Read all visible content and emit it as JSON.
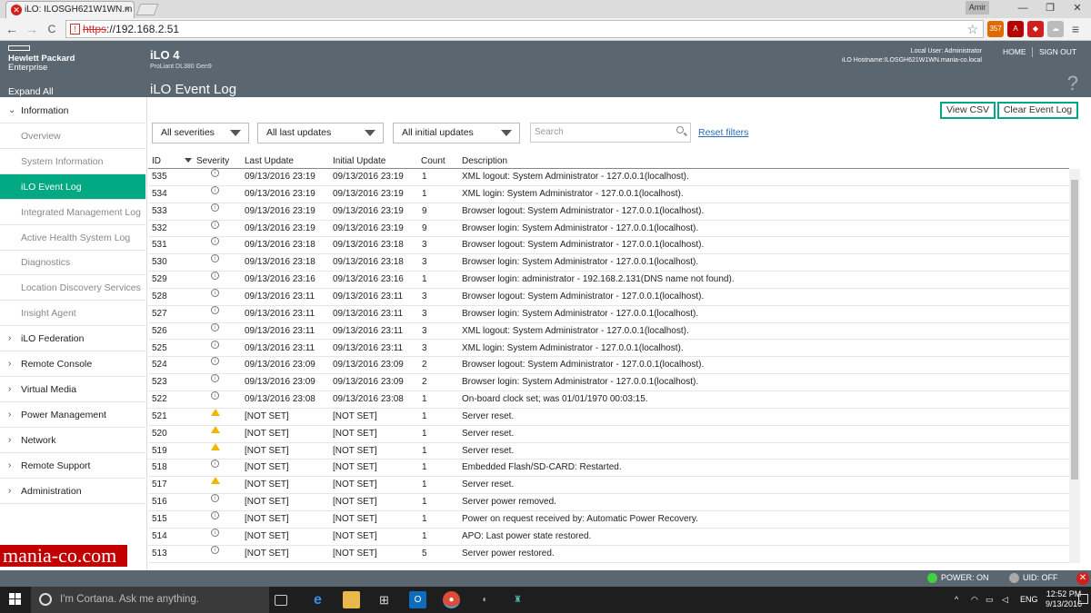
{
  "browser": {
    "tab_title": "iLO: ILOSGH621W1WN.m",
    "tab_close": "×",
    "profile_name": "Amir",
    "win_minimize": "—",
    "win_restore": "❐",
    "win_close": "✕",
    "back": "←",
    "forward": "→",
    "reload": "C",
    "url_scheme": "https",
    "url_rest": "://192.168.2.51",
    "star": "☆",
    "ext_badge": "357"
  },
  "header": {
    "brand_line1": "Hewlett Packard",
    "brand_line2": "Enterprise",
    "expand_all": "Expand All",
    "product": "iLO 4",
    "model": "ProLiant DL380 Gen9",
    "page_title": "iLO Event Log",
    "local_user": "Local User:  Administrator",
    "hostname": "iLO Hostname:ILOSGH621W1WN.mania-co.local",
    "home": "HOME",
    "signout": "SIGN OUT",
    "help": "?"
  },
  "sidebar": {
    "information": "Information",
    "sub_items": [
      "Overview",
      "System Information",
      "iLO Event Log",
      "Integrated Management Log",
      "Active Health System Log",
      "Diagnostics",
      "Location Discovery Services",
      "Insight Agent"
    ],
    "active_index": 2,
    "sections": [
      "iLO Federation",
      "Remote Console",
      "Virtual Media",
      "Power Management",
      "Network",
      "Remote Support",
      "Administration"
    ]
  },
  "toolbar": {
    "view_csv": "View CSV",
    "clear_log": "Clear Event Log",
    "severity_filter": "All severities",
    "last_update_filter": "All last updates",
    "initial_update_filter": "All initial updates",
    "search_placeholder": "Search",
    "reset_filters": "Reset filters"
  },
  "table": {
    "columns": [
      "ID",
      "Severity",
      "Last Update",
      "Initial Update",
      "Count",
      "Description"
    ],
    "rows": [
      {
        "id": "535",
        "sev": "info",
        "last": "09/13/2016 23:19",
        "init": "09/13/2016 23:19",
        "count": "1",
        "desc": "XML logout: System Administrator - 127.0.0.1(localhost)."
      },
      {
        "id": "534",
        "sev": "info",
        "last": "09/13/2016 23:19",
        "init": "09/13/2016 23:19",
        "count": "1",
        "desc": "XML login: System Administrator - 127.0.0.1(localhost)."
      },
      {
        "id": "533",
        "sev": "info",
        "last": "09/13/2016 23:19",
        "init": "09/13/2016 23:19",
        "count": "9",
        "desc": "Browser logout: System Administrator - 127.0.0.1(localhost)."
      },
      {
        "id": "532",
        "sev": "info",
        "last": "09/13/2016 23:19",
        "init": "09/13/2016 23:19",
        "count": "9",
        "desc": "Browser login: System Administrator - 127.0.0.1(localhost)."
      },
      {
        "id": "531",
        "sev": "info",
        "last": "09/13/2016 23:18",
        "init": "09/13/2016 23:18",
        "count": "3",
        "desc": "Browser logout: System Administrator - 127.0.0.1(localhost)."
      },
      {
        "id": "530",
        "sev": "info",
        "last": "09/13/2016 23:18",
        "init": "09/13/2016 23:18",
        "count": "3",
        "desc": "Browser login: System Administrator - 127.0.0.1(localhost)."
      },
      {
        "id": "529",
        "sev": "info",
        "last": "09/13/2016 23:16",
        "init": "09/13/2016 23:16",
        "count": "1",
        "desc": "Browser login: administrator - 192.168.2.131(DNS name not found)."
      },
      {
        "id": "528",
        "sev": "info",
        "last": "09/13/2016 23:11",
        "init": "09/13/2016 23:11",
        "count": "3",
        "desc": "Browser logout: System Administrator - 127.0.0.1(localhost)."
      },
      {
        "id": "527",
        "sev": "info",
        "last": "09/13/2016 23:11",
        "init": "09/13/2016 23:11",
        "count": "3",
        "desc": "Browser login: System Administrator - 127.0.0.1(localhost)."
      },
      {
        "id": "526",
        "sev": "info",
        "last": "09/13/2016 23:11",
        "init": "09/13/2016 23:11",
        "count": "3",
        "desc": "XML logout: System Administrator - 127.0.0.1(localhost)."
      },
      {
        "id": "525",
        "sev": "info",
        "last": "09/13/2016 23:11",
        "init": "09/13/2016 23:11",
        "count": "3",
        "desc": "XML login: System Administrator - 127.0.0.1(localhost)."
      },
      {
        "id": "524",
        "sev": "info",
        "last": "09/13/2016 23:09",
        "init": "09/13/2016 23:09",
        "count": "2",
        "desc": "Browser logout: System Administrator - 127.0.0.1(localhost)."
      },
      {
        "id": "523",
        "sev": "info",
        "last": "09/13/2016 23:09",
        "init": "09/13/2016 23:09",
        "count": "2",
        "desc": "Browser login: System Administrator - 127.0.0.1(localhost)."
      },
      {
        "id": "522",
        "sev": "info",
        "last": "09/13/2016 23:08",
        "init": "09/13/2016 23:08",
        "count": "1",
        "desc": "On-board clock set; was 01/01/1970  00:03:15."
      },
      {
        "id": "521",
        "sev": "warn",
        "last": "[NOT SET]",
        "init": "[NOT SET]",
        "count": "1",
        "desc": "Server reset."
      },
      {
        "id": "520",
        "sev": "warn",
        "last": "[NOT SET]",
        "init": "[NOT SET]",
        "count": "1",
        "desc": "Server reset."
      },
      {
        "id": "519",
        "sev": "warn",
        "last": "[NOT SET]",
        "init": "[NOT SET]",
        "count": "1",
        "desc": "Server reset."
      },
      {
        "id": "518",
        "sev": "info",
        "last": "[NOT SET]",
        "init": "[NOT SET]",
        "count": "1",
        "desc": "Embedded Flash/SD-CARD: Restarted."
      },
      {
        "id": "517",
        "sev": "warn",
        "last": "[NOT SET]",
        "init": "[NOT SET]",
        "count": "1",
        "desc": "Server reset."
      },
      {
        "id": "516",
        "sev": "info",
        "last": "[NOT SET]",
        "init": "[NOT SET]",
        "count": "1",
        "desc": "Server power removed."
      },
      {
        "id": "515",
        "sev": "info",
        "last": "[NOT SET]",
        "init": "[NOT SET]",
        "count": "1",
        "desc": "Power on request received by: Automatic Power Recovery."
      },
      {
        "id": "514",
        "sev": "info",
        "last": "[NOT SET]",
        "init": "[NOT SET]",
        "count": "1",
        "desc": "APO: Last power state restored."
      },
      {
        "id": "513",
        "sev": "info",
        "last": "[NOT SET]",
        "init": "[NOT SET]",
        "count": "5",
        "desc": "Server power restored."
      }
    ]
  },
  "status_bar": {
    "power": "POWER: ON",
    "uid": "UID: OFF",
    "close": "✕"
  },
  "watermark": "mania-co.com",
  "taskbar": {
    "cortana": "I'm Cortana. Ask me anything.",
    "lang": "ENG",
    "time": "12:52 PM",
    "date": "9/13/2016",
    "tray_up": "^"
  },
  "colors": {
    "accent": "#01a982",
    "header": "#5a6670",
    "link": "#2a6ebb",
    "warning": "#f2b600"
  }
}
